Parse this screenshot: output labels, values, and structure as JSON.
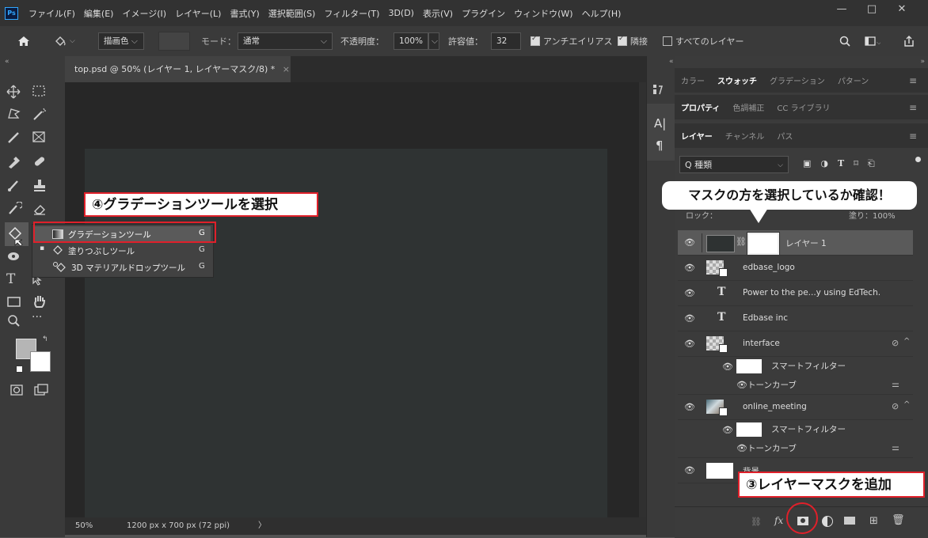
{
  "app": {
    "logo": "Ps"
  },
  "menu": [
    "ファイル(F)",
    "編集(E)",
    "イメージ(I)",
    "レイヤー(L)",
    "書式(Y)",
    "選択範囲(S)",
    "フィルター(T)",
    "3D(D)",
    "表示(V)",
    "プラグイン",
    "ウィンドウ(W)",
    "ヘルプ(H)"
  ],
  "window_controls": {
    "minimize": "—",
    "maximize": "□",
    "close": "✕"
  },
  "options": {
    "home_icon": "home-icon",
    "fill_source": "描画色",
    "mode_label": "モード：",
    "mode_value": "通常",
    "opacity_label": "不透明度：",
    "opacity_value": "100%",
    "tolerance_label": "許容値：",
    "tolerance_value": "32",
    "antialias": "アンチエイリアス",
    "antialias_checked": true,
    "contiguous": "隣接",
    "contiguous_checked": true,
    "all_layers": "すべてのレイヤー",
    "all_layers_checked": false
  },
  "document": {
    "tab_title": "top.psd @ 50% (レイヤー 1, レイヤーマスク/8) *",
    "tab_close": "×",
    "zoom": "50%",
    "doc_info": "1200 px x 700 px (72 ppi)",
    "status_arrow": "〉"
  },
  "tool_flyout": [
    {
      "label": "グラデーションツール",
      "key": "G",
      "selected": true
    },
    {
      "label": "塗りつぶしツール",
      "key": "G",
      "selected": false
    },
    {
      "label": "3D マテリアルドロップツール",
      "key": "G",
      "selected": false
    }
  ],
  "panels": {
    "row1": {
      "tabs": [
        "カラー",
        "スウォッチ",
        "グラデーション",
        "パターン"
      ],
      "active": 1
    },
    "row2": {
      "tabs": [
        "プロパティ",
        "色調補正",
        "CC ライブラリ"
      ],
      "active": 0
    },
    "row3": {
      "tabs": [
        "レイヤー",
        "チャンネル",
        "パス"
      ],
      "active": 0
    },
    "menu_icon": "≡"
  },
  "layers_panel": {
    "filter_label": "Q 種類",
    "lock_partial": "ロック：",
    "fill_partial": "塗り：100%",
    "layers": [
      {
        "name": "レイヤー 1",
        "kind": "layer-with-mask",
        "selected": true
      },
      {
        "name": "edbase_logo",
        "kind": "smart"
      },
      {
        "name": "Power to the pe...y using EdTech.",
        "kind": "text"
      },
      {
        "name": "Edbase inc",
        "kind": "text"
      },
      {
        "name": "interface",
        "kind": "smart",
        "has_filters": true
      },
      {
        "name": "スマートフィルター",
        "kind": "filter-mask"
      },
      {
        "name": "トーンカーブ",
        "kind": "filter"
      },
      {
        "name": "online_meeting",
        "kind": "smart-photo",
        "has_filters": true
      },
      {
        "name": "スマートフィルター",
        "kind": "filter-mask"
      },
      {
        "name": "トーンカーブ",
        "kind": "filter"
      },
      {
        "name": "背景",
        "kind": "background"
      }
    ],
    "text_glyph": "T"
  },
  "annotations": {
    "step4": "④グラデーションツールを選択",
    "step3": "③レイヤーマスクを追加",
    "bubble": "マスクの方を選択しているか確認！"
  },
  "colors": {
    "accent_red": "#e0202a",
    "selected_layer": "#5a5a5a",
    "canvas_bg": "#2f3333"
  }
}
